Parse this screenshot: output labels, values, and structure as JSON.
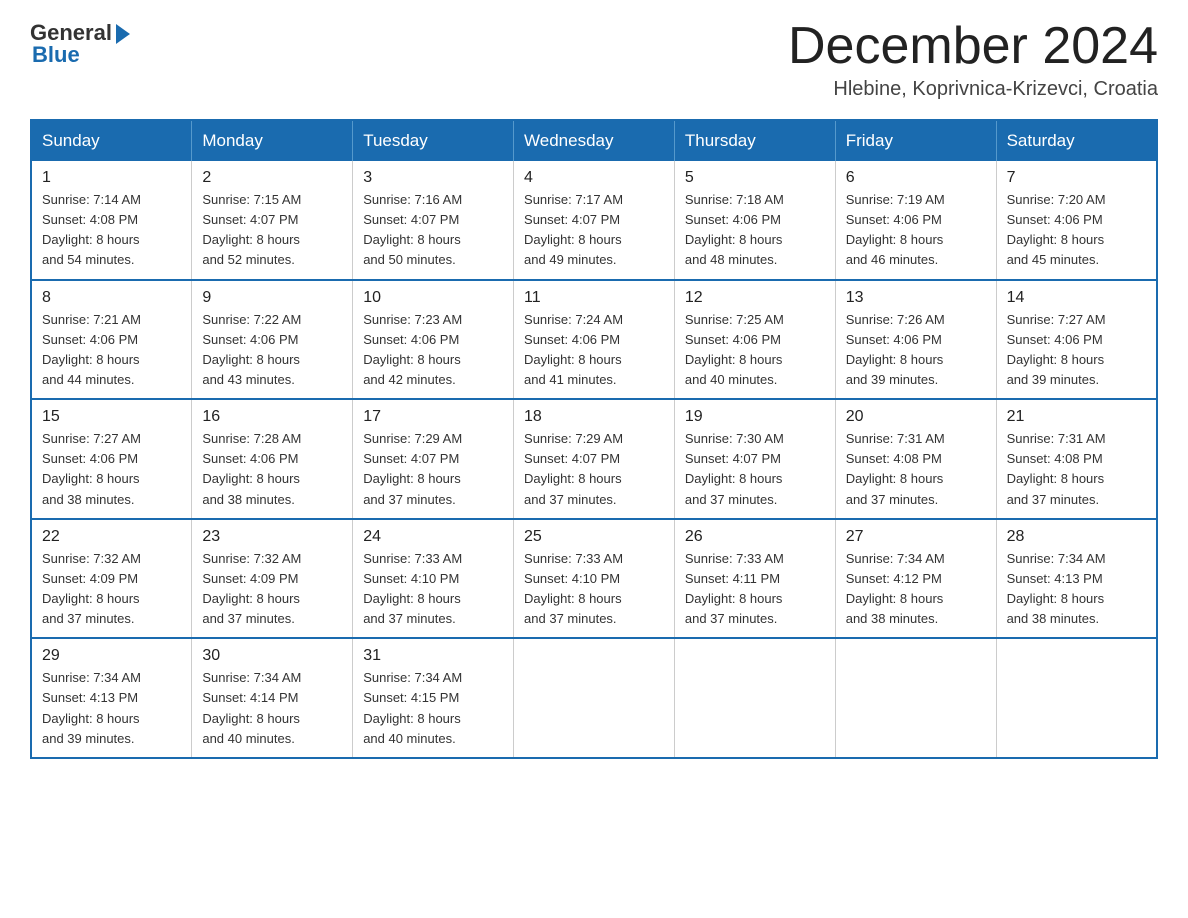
{
  "header": {
    "logo_general": "General",
    "logo_blue": "Blue",
    "month_title": "December 2024",
    "location": "Hlebine, Koprivnica-Krizevci, Croatia"
  },
  "days_of_week": [
    "Sunday",
    "Monday",
    "Tuesday",
    "Wednesday",
    "Thursday",
    "Friday",
    "Saturday"
  ],
  "weeks": [
    [
      {
        "day": "1",
        "sunrise": "7:14 AM",
        "sunset": "4:08 PM",
        "daylight": "8 hours and 54 minutes."
      },
      {
        "day": "2",
        "sunrise": "7:15 AM",
        "sunset": "4:07 PM",
        "daylight": "8 hours and 52 minutes."
      },
      {
        "day": "3",
        "sunrise": "7:16 AM",
        "sunset": "4:07 PM",
        "daylight": "8 hours and 50 minutes."
      },
      {
        "day": "4",
        "sunrise": "7:17 AM",
        "sunset": "4:07 PM",
        "daylight": "8 hours and 49 minutes."
      },
      {
        "day": "5",
        "sunrise": "7:18 AM",
        "sunset": "4:06 PM",
        "daylight": "8 hours and 48 minutes."
      },
      {
        "day": "6",
        "sunrise": "7:19 AM",
        "sunset": "4:06 PM",
        "daylight": "8 hours and 46 minutes."
      },
      {
        "day": "7",
        "sunrise": "7:20 AM",
        "sunset": "4:06 PM",
        "daylight": "8 hours and 45 minutes."
      }
    ],
    [
      {
        "day": "8",
        "sunrise": "7:21 AM",
        "sunset": "4:06 PM",
        "daylight": "8 hours and 44 minutes."
      },
      {
        "day": "9",
        "sunrise": "7:22 AM",
        "sunset": "4:06 PM",
        "daylight": "8 hours and 43 minutes."
      },
      {
        "day": "10",
        "sunrise": "7:23 AM",
        "sunset": "4:06 PM",
        "daylight": "8 hours and 42 minutes."
      },
      {
        "day": "11",
        "sunrise": "7:24 AM",
        "sunset": "4:06 PM",
        "daylight": "8 hours and 41 minutes."
      },
      {
        "day": "12",
        "sunrise": "7:25 AM",
        "sunset": "4:06 PM",
        "daylight": "8 hours and 40 minutes."
      },
      {
        "day": "13",
        "sunrise": "7:26 AM",
        "sunset": "4:06 PM",
        "daylight": "8 hours and 39 minutes."
      },
      {
        "day": "14",
        "sunrise": "7:27 AM",
        "sunset": "4:06 PM",
        "daylight": "8 hours and 39 minutes."
      }
    ],
    [
      {
        "day": "15",
        "sunrise": "7:27 AM",
        "sunset": "4:06 PM",
        "daylight": "8 hours and 38 minutes."
      },
      {
        "day": "16",
        "sunrise": "7:28 AM",
        "sunset": "4:06 PM",
        "daylight": "8 hours and 38 minutes."
      },
      {
        "day": "17",
        "sunrise": "7:29 AM",
        "sunset": "4:07 PM",
        "daylight": "8 hours and 37 minutes."
      },
      {
        "day": "18",
        "sunrise": "7:29 AM",
        "sunset": "4:07 PM",
        "daylight": "8 hours and 37 minutes."
      },
      {
        "day": "19",
        "sunrise": "7:30 AM",
        "sunset": "4:07 PM",
        "daylight": "8 hours and 37 minutes."
      },
      {
        "day": "20",
        "sunrise": "7:31 AM",
        "sunset": "4:08 PM",
        "daylight": "8 hours and 37 minutes."
      },
      {
        "day": "21",
        "sunrise": "7:31 AM",
        "sunset": "4:08 PM",
        "daylight": "8 hours and 37 minutes."
      }
    ],
    [
      {
        "day": "22",
        "sunrise": "7:32 AM",
        "sunset": "4:09 PM",
        "daylight": "8 hours and 37 minutes."
      },
      {
        "day": "23",
        "sunrise": "7:32 AM",
        "sunset": "4:09 PM",
        "daylight": "8 hours and 37 minutes."
      },
      {
        "day": "24",
        "sunrise": "7:33 AM",
        "sunset": "4:10 PM",
        "daylight": "8 hours and 37 minutes."
      },
      {
        "day": "25",
        "sunrise": "7:33 AM",
        "sunset": "4:10 PM",
        "daylight": "8 hours and 37 minutes."
      },
      {
        "day": "26",
        "sunrise": "7:33 AM",
        "sunset": "4:11 PM",
        "daylight": "8 hours and 37 minutes."
      },
      {
        "day": "27",
        "sunrise": "7:34 AM",
        "sunset": "4:12 PM",
        "daylight": "8 hours and 38 minutes."
      },
      {
        "day": "28",
        "sunrise": "7:34 AM",
        "sunset": "4:13 PM",
        "daylight": "8 hours and 38 minutes."
      }
    ],
    [
      {
        "day": "29",
        "sunrise": "7:34 AM",
        "sunset": "4:13 PM",
        "daylight": "8 hours and 39 minutes."
      },
      {
        "day": "30",
        "sunrise": "7:34 AM",
        "sunset": "4:14 PM",
        "daylight": "8 hours and 40 minutes."
      },
      {
        "day": "31",
        "sunrise": "7:34 AM",
        "sunset": "4:15 PM",
        "daylight": "8 hours and 40 minutes."
      },
      null,
      null,
      null,
      null
    ]
  ],
  "labels": {
    "sunrise": "Sunrise:",
    "sunset": "Sunset:",
    "daylight": "Daylight:"
  }
}
